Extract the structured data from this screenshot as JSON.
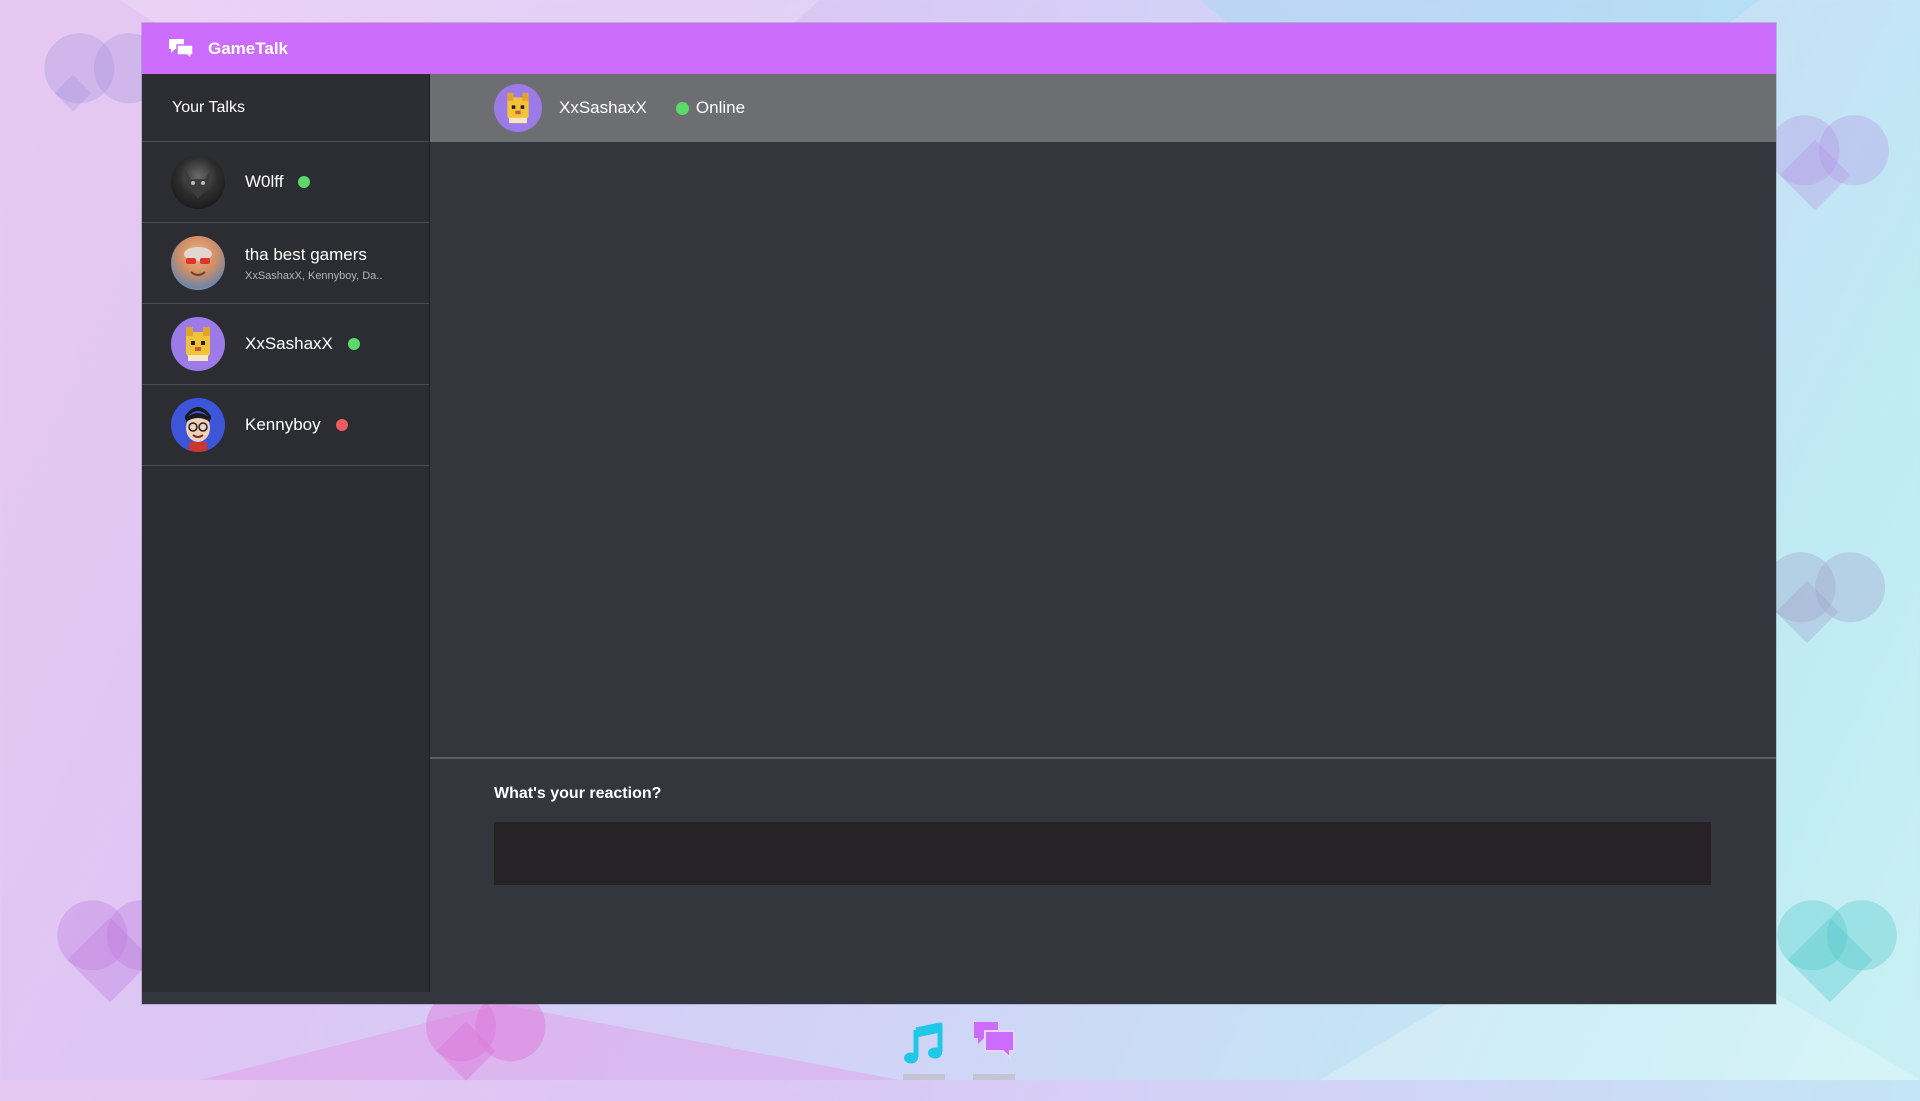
{
  "app": {
    "title": "GameTalk",
    "accent_color": "#cb6cfd"
  },
  "sidebar": {
    "header": "Your Talks",
    "items": [
      {
        "name": "W0lff",
        "status": "online",
        "avatar": "wolf-avatar"
      },
      {
        "name": "tha best gamers",
        "members": "XxSashaxX, Kennyboy, Da..",
        "avatar": "group-avatar"
      },
      {
        "name": "XxSashaxX",
        "status": "online",
        "avatar": "dog-avatar"
      },
      {
        "name": "Kennyboy",
        "status": "offline",
        "avatar": "cartoon-boy-avatar"
      }
    ]
  },
  "chat": {
    "contact_name": "XxSashaxX",
    "contact_status": "Online",
    "online_color": "#5bd96b",
    "offline_color": "#ef5a63"
  },
  "composer": {
    "label": "What's your reaction?",
    "placeholder": ""
  },
  "dock": {
    "items": [
      {
        "icon": "music-note-icon",
        "color": "#1ec8e6"
      },
      {
        "icon": "chat-bubbles-icon",
        "color": "#cb6cfd"
      }
    ]
  }
}
